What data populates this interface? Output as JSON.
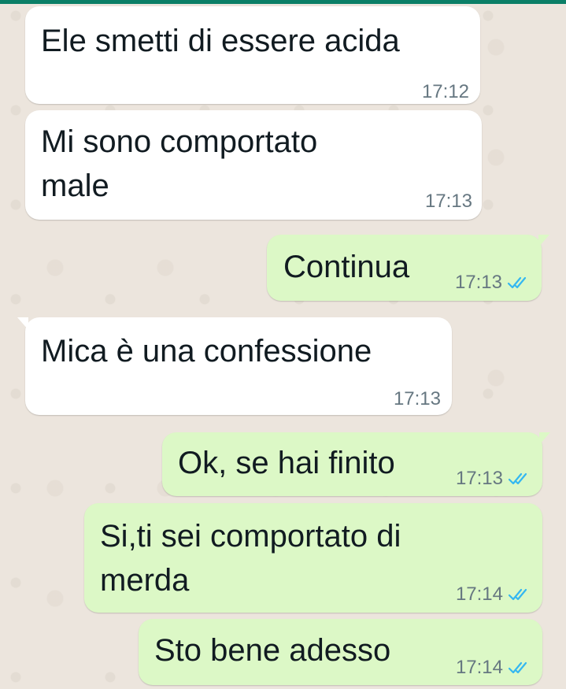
{
  "colors": {
    "top_bar": "#0b7f67",
    "incoming_bubble": "#ffffff",
    "outgoing_bubble": "#dcf8c6",
    "read_ticks": "#34b7f1",
    "timestamp": "#667781",
    "wallpaper": "#ece5dd"
  },
  "messages": [
    {
      "direction": "incoming",
      "lines": [
        "Ele smetti di essere acida"
      ],
      "time": "17:12"
    },
    {
      "direction": "incoming",
      "lines": [
        "Mi sono comportato",
        "male"
      ],
      "time": "17:13"
    },
    {
      "direction": "outgoing",
      "lines": [
        "Continua"
      ],
      "time": "17:13",
      "status": "read"
    },
    {
      "direction": "incoming",
      "lines": [
        "Mica è una confessione"
      ],
      "time": "17:13"
    },
    {
      "direction": "outgoing",
      "lines": [
        "Ok, se hai finito"
      ],
      "time": "17:13",
      "status": "read"
    },
    {
      "direction": "outgoing",
      "lines": [
        "Si,ti sei comportato di",
        "merda"
      ],
      "time": "17:14",
      "status": "read"
    },
    {
      "direction": "outgoing",
      "lines": [
        "Sto bene adesso"
      ],
      "time": "17:14",
      "status": "read"
    }
  ]
}
